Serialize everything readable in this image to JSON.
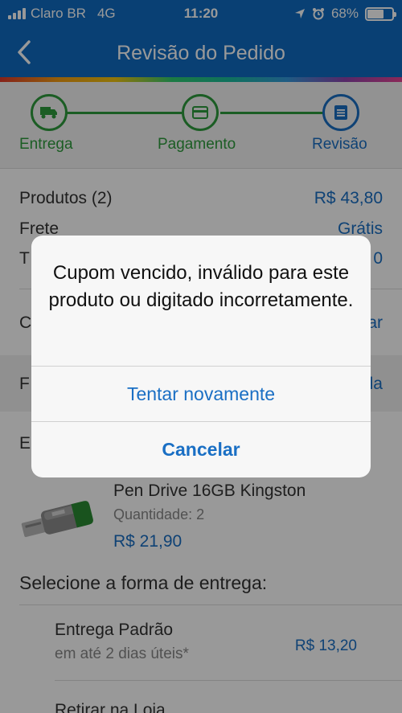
{
  "status_bar": {
    "carrier": "Claro BR",
    "network": "4G",
    "time": "11:20",
    "battery": "68%",
    "battery_level": 0.68
  },
  "nav": {
    "title": "Revisão do Pedido"
  },
  "steps": [
    {
      "label": "Entrega",
      "icon": "truck-icon",
      "color": "#2e9b3c"
    },
    {
      "label": "Pagamento",
      "icon": "credit-card-icon",
      "color": "#2e9b3c"
    },
    {
      "label": "Revisão",
      "icon": "list-icon",
      "color": "#1a6fc4"
    }
  ],
  "summary": {
    "products_label": "Produtos (2)",
    "products_value": "R$ 43,80",
    "shipping_label": "Frete",
    "shipping_value": "Grátis",
    "total_label_partial": "T",
    "total_value_partial": "0",
    "coupon_label_partial": "C",
    "coupon_action_partial": "ar",
    "payment_label_partial": "F",
    "payment_action_partial": "la",
    "delivery_label_partial": "E"
  },
  "product": {
    "name": "Pen Drive 16GB Kingston",
    "quantity": "Quantidade: 2",
    "price": "R$ 21,90"
  },
  "delivery": {
    "section_title": "Selecione a forma de entrega:",
    "options": [
      {
        "name": "Entrega Padrão",
        "sub": "em até 2 dias úteis*",
        "price": "R$ 13,20"
      },
      {
        "name": "Retirar na Loja",
        "sub": "",
        "price": ""
      }
    ]
  },
  "alert": {
    "message": "Cupom vencido, inválido para este produto ou digitado incorretamente.",
    "retry_label": "Tentar novamente",
    "cancel_label": "Cancelar"
  },
  "colors": {
    "brand_blue": "#0f6cc2",
    "link_blue": "#1a6fc4",
    "step_green": "#2e9b3c"
  }
}
